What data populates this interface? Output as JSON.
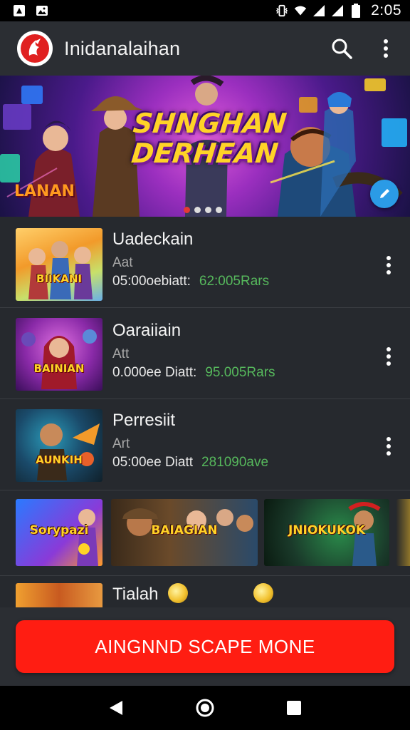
{
  "status_bar": {
    "time": "2:05"
  },
  "app_bar": {
    "title": "Inidanalaihan"
  },
  "banner": {
    "title_line1": "SHNGHAN",
    "title_line2": "DERHEAN",
    "corner_text": "LANAN",
    "slide_count": 4,
    "active_slide": 1
  },
  "list": {
    "items": [
      {
        "title": "Uadeckain",
        "subtitle": "Aat",
        "meta": "05:00oebiatt:",
        "stat": "62:005Rars",
        "thumb_text": "BIIKANI"
      },
      {
        "title": "Oaraiiain",
        "subtitle": "Att",
        "meta": "0.000ee Diatt:",
        "stat": "95.005Rars",
        "thumb_text": "BAINIAN"
      },
      {
        "title": "Perresiit",
        "subtitle": "Art",
        "meta": "05:00ee Diatt",
        "stat": "281090ave",
        "thumb_text": "AUNKIH"
      }
    ]
  },
  "strip": {
    "cards": [
      {
        "text": "Sorypazi"
      },
      {
        "text": "BAIAGIAN"
      },
      {
        "text": "JNIOKUKOK"
      }
    ]
  },
  "partial_row": {
    "title": "Tialah"
  },
  "cta": {
    "label": "AINGNND SCAPE MONE"
  },
  "colors": {
    "accent_red": "#ff1d12",
    "stat_green": "#56b85c",
    "fab_blue": "#2b9be6",
    "banner_title": "#ffd327"
  }
}
